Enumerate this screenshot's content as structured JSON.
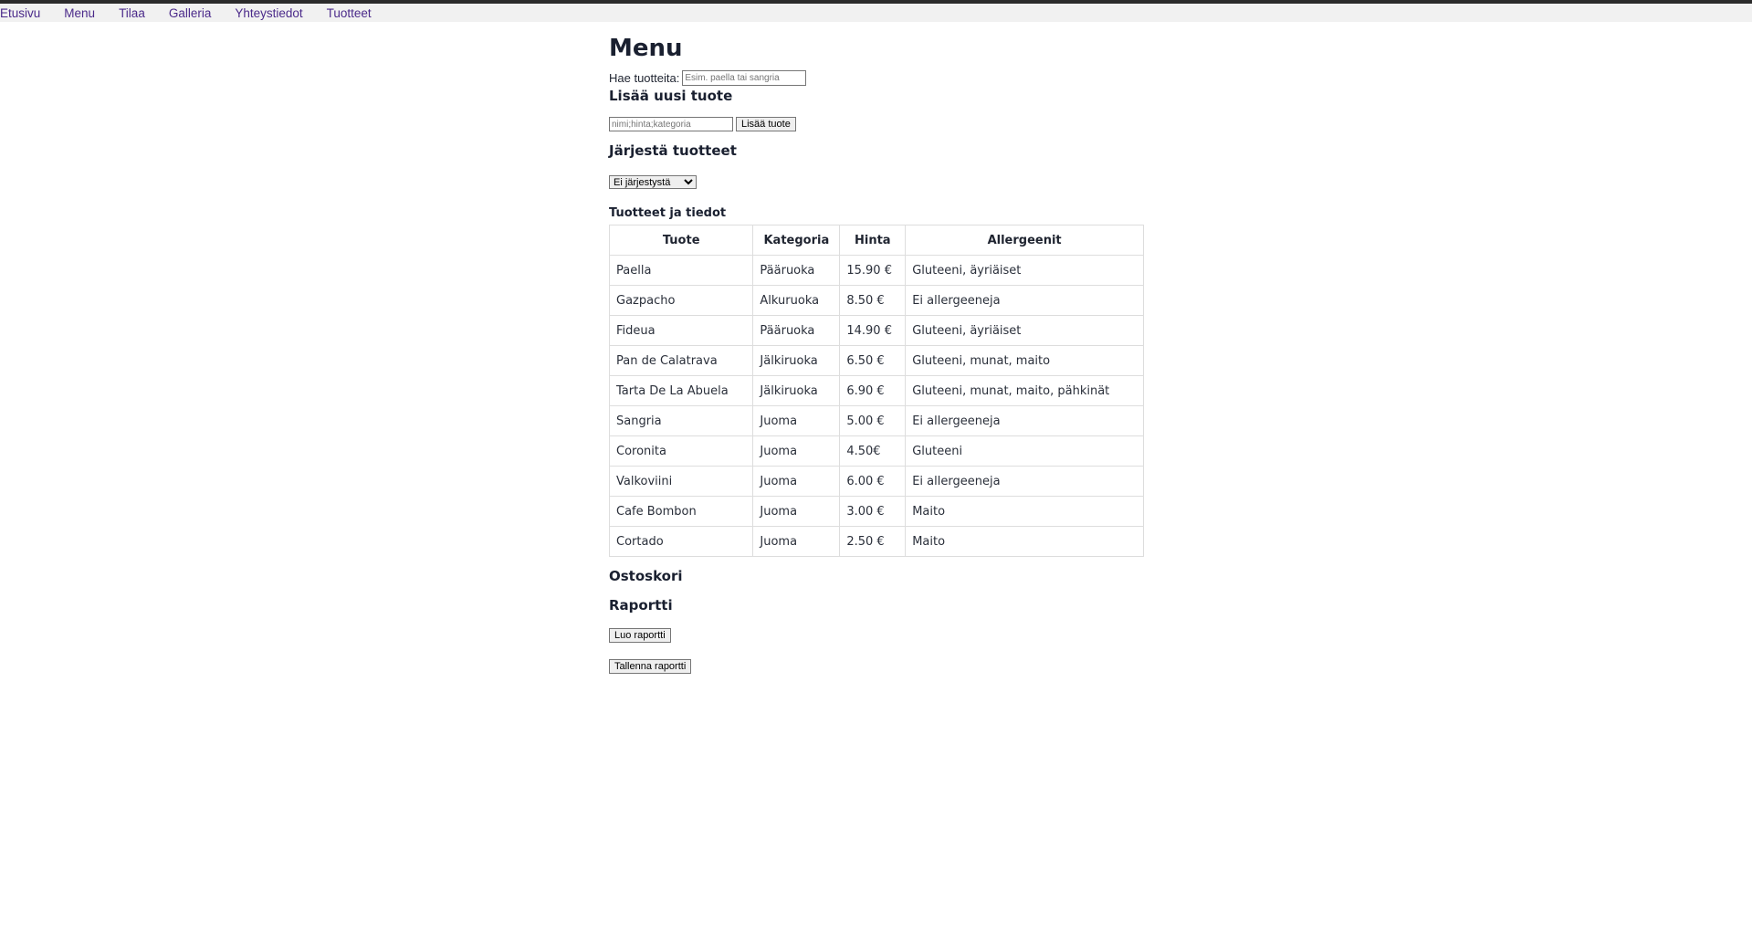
{
  "nav": [
    "Etusivu",
    "Menu",
    "Tilaa",
    "Galleria",
    "Yhteystiedot",
    "Tuotteet"
  ],
  "page_title": "Menu",
  "search": {
    "label": "Hae tuotteita:",
    "placeholder": "Esim. paella tai sangria",
    "value": ""
  },
  "add_product": {
    "title": "Lisää uusi tuote",
    "placeholder": "nimi;hinta;kategoria",
    "button_label": "Lisää tuote"
  },
  "sort": {
    "title": "Järjestä tuotteet",
    "selected": "Ei järjestystä"
  },
  "products": {
    "title": "Tuotteet ja tiedot",
    "headers": [
      "Tuote",
      "Kategoria",
      "Hinta",
      "Allergeenit"
    ],
    "rows": [
      [
        "Paella",
        "Pääruoka",
        "15.90 €",
        "Gluteeni, äyriäiset"
      ],
      [
        "Gazpacho",
        "Alkuruoka",
        "8.50 €",
        "Ei allergeeneja"
      ],
      [
        "Fideua",
        "Pääruoka",
        "14.90 €",
        "Gluteeni, äyriäiset"
      ],
      [
        "Pan de Calatrava",
        "Jälkiruoka",
        "6.50 €",
        "Gluteeni, munat, maito"
      ],
      [
        "Tarta De La Abuela",
        "Jälkiruoka",
        "6.90 €",
        "Gluteeni, munat, maito, pähkinät"
      ],
      [
        "Sangria",
        "Juoma",
        "5.00 €",
        "Ei allergeeneja"
      ],
      [
        "Coronita",
        "Juoma",
        "4.50€",
        "Gluteeni"
      ],
      [
        "Valkoviini",
        "Juoma",
        "6.00 €",
        "Ei allergeeneja"
      ],
      [
        "Cafe Bombon",
        "Juoma",
        "3.00 €",
        "Maito"
      ],
      [
        "Cortado",
        "Juoma",
        "2.50 €",
        "Maito"
      ]
    ]
  },
  "cart": {
    "title": "Ostoskori"
  },
  "report": {
    "title": "Raportti",
    "create_label": "Luo raportti",
    "save_label": "Tallenna raportti"
  },
  "colors": {
    "nav_link": "#4b2a8a",
    "nav_bg": "#f1f1f1",
    "top_border": "#2b2b2b"
  }
}
